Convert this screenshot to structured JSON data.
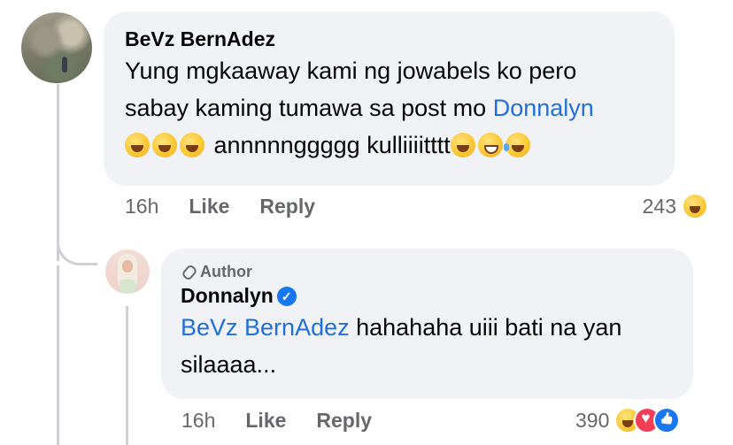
{
  "comment": {
    "author": "BeVz BernAdez",
    "text_line1": "Yung mgkaaway kami ng jowabels ko pero",
    "text_line2_pre": "sabay kaming tumawa sa post mo ",
    "mention": "Donnalyn",
    "text_line3": "annnnnggggg kulliiiitttt",
    "time": "16h",
    "like_label": "Like",
    "reply_label": "Reply",
    "reaction_count": "243",
    "reaction_icons": [
      "haha-icon"
    ]
  },
  "reply": {
    "badge": "Author",
    "author": "Donnalyn",
    "verified_icon": "verified-badge-icon",
    "mention": "BeVz BernAdez",
    "text_line1": " hahahaha uiii bati na yan",
    "text_line2": "silaaaa...",
    "time": "16h",
    "like_label": "Like",
    "reply_label": "Reply",
    "reaction_count": "390",
    "reaction_icons": [
      "haha-icon",
      "love-icon",
      "like-icon"
    ]
  },
  "colors": {
    "bubble": "#f0f2f5",
    "mention": "#216fdb",
    "meta": "#65676b",
    "thread_line": "#ced0d4"
  }
}
